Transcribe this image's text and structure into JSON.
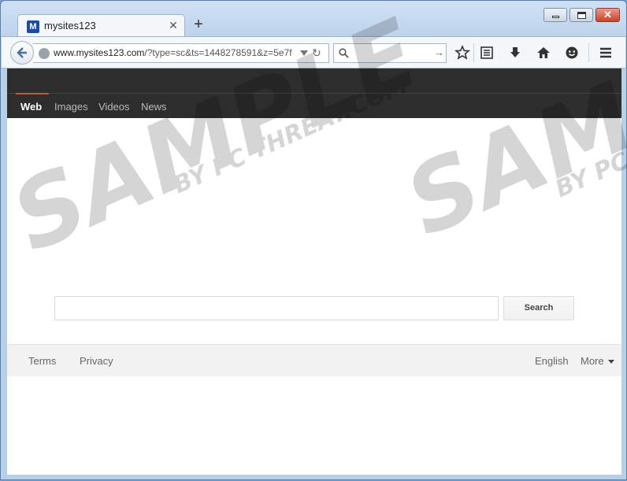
{
  "browser": {
    "tab": {
      "favicon_letter": "M",
      "title": "mysites123",
      "close_glyph": "✕"
    },
    "new_tab_glyph": "+",
    "window_controls": {
      "close_glyph": "✕"
    },
    "url": {
      "host": "www.mysites123.com",
      "rest": "/?type=sc&ts=1448278591&z=5e7f"
    },
    "search_go_glyph": "→",
    "reload_glyph": "↻",
    "icons": [
      "back-arrow-icon",
      "globe-icon",
      "dropdown-icon",
      "reload-icon",
      "search-icon",
      "go-arrow-icon",
      "bookmark-star-icon",
      "reading-list-icon",
      "download-icon",
      "home-icon",
      "chat-icon",
      "hamburger-menu-icon"
    ]
  },
  "page": {
    "menu": [
      {
        "label": "Web",
        "active": true
      },
      {
        "label": "Images",
        "active": false
      },
      {
        "label": "Videos",
        "active": false
      },
      {
        "label": "News",
        "active": false
      }
    ],
    "search": {
      "input_value": "",
      "button_label": "Search"
    },
    "footer": {
      "terms": "Terms",
      "privacy": "Privacy",
      "language": "English",
      "more": "More"
    }
  },
  "colors": {
    "menu_bg": "#2d2d2d",
    "active_underline": "#dd4b39",
    "footer_bg": "#f2f2f2"
  }
}
